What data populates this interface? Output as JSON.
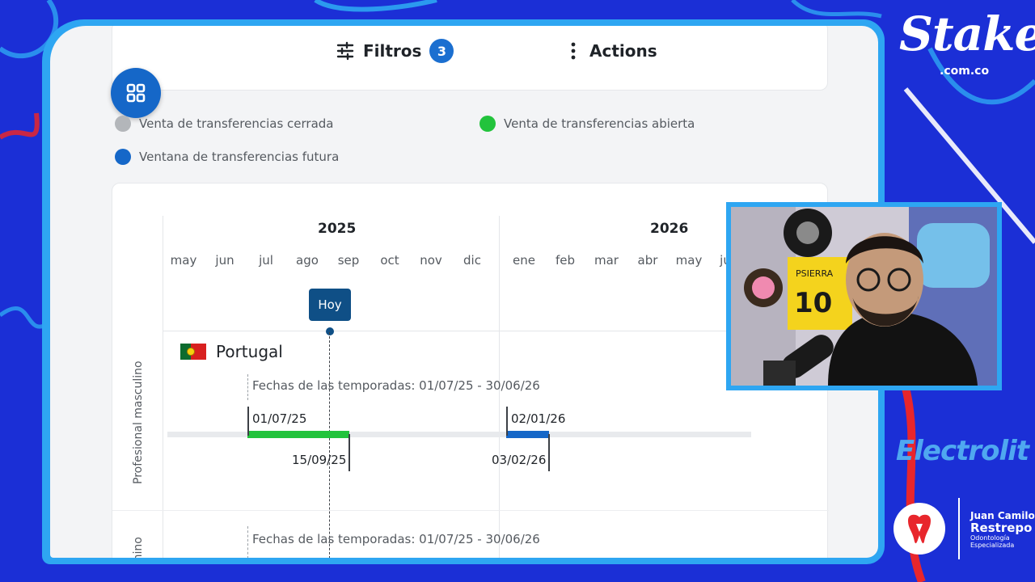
{
  "toolbar": {
    "filters_label": "Filtros",
    "filters_count": "3",
    "actions_label": "Actions"
  },
  "legend": {
    "closed": "Venta de transferencias cerrada",
    "open": "Venta de transferencias abierta",
    "future": "Ventana de transferencias futura",
    "colors": {
      "closed": "#b3b6ba",
      "open": "#22c33c",
      "future": "#1567c8"
    }
  },
  "timeline": {
    "years": [
      "2025",
      "2026"
    ],
    "months": [
      "may",
      "jun",
      "jul",
      "ago",
      "sep",
      "oct",
      "nov",
      "dic",
      "ene",
      "feb",
      "mar",
      "abr",
      "may",
      "ju"
    ],
    "today_label": "Hoy",
    "section_male": "Profesional masculino",
    "section_female": "enino",
    "country": "Portugal",
    "season_text": "Fechas de las temporadas: 01/07/25 - 30/06/26",
    "season_text_2": "Fechas de las temporadas: 01/07/25 - 30/06/26",
    "window1_start": "01/07/25",
    "window1_end": "15/09/25",
    "window2_start": "02/01/26",
    "window2_end": "03/02/26"
  },
  "overlay": {
    "brand_1": "Stake",
    "brand_1_sub": ".com.co",
    "brand_2": "Electrolit",
    "doctor": {
      "first": "Juan Camilo",
      "last": "Restrepo",
      "sub1": "Odontología",
      "sub2": "Especializada"
    },
    "cam_poster_text": "PSIERRA",
    "cam_poster_num": "10"
  }
}
